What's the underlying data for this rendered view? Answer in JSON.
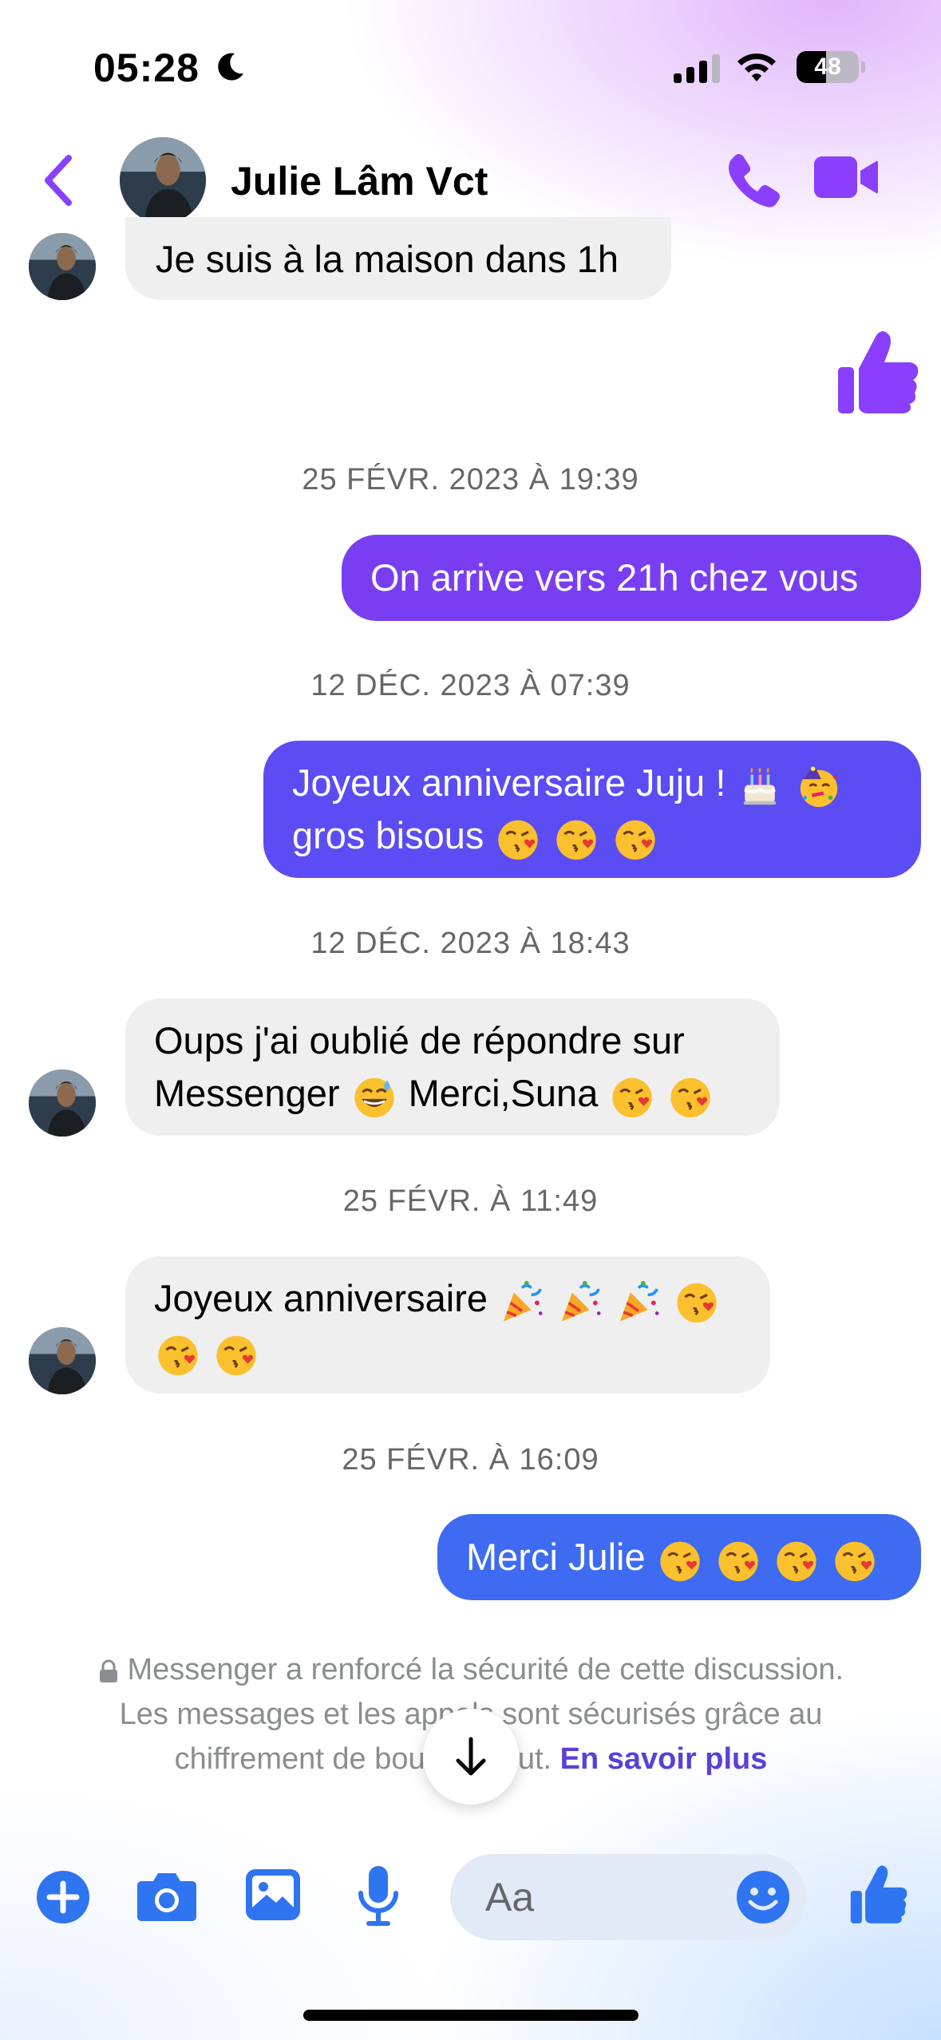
{
  "status_bar": {
    "time": "05:28",
    "battery": "48",
    "battery_fraction": 0.48
  },
  "header": {
    "contact_name": "Julie Lâm Vct"
  },
  "messages": [
    {
      "text": "Je suis à la maison dans 1h"
    },
    {
      "timestamp": "25 FÉVR. 2023 À 19:39"
    },
    {
      "text": "On arrive vers 21h chez vous"
    },
    {
      "timestamp": "12 DÉC. 2023 À 07:39"
    },
    {
      "line1": "Joyeux anniversaire Juju !",
      "line2": "gros bisous"
    },
    {
      "timestamp": "12 DÉC. 2023 À 18:43"
    },
    {
      "line1": "Oups j'ai oublié de répondre sur",
      "line2a": "Messenger",
      "line2b": "Merci,Suna"
    },
    {
      "timestamp": "25 FÉVR. À 11:49"
    },
    {
      "line1": "Joyeux anniversaire"
    },
    {
      "timestamp": "25 FÉVR. À 16:09"
    },
    {
      "text": "Merci Julie"
    }
  ],
  "security_notice": {
    "line1": "Messenger a renforcé la sécurité de cette discussion.",
    "line2": "Les messages et les appels sont sécurisés grâce au",
    "line3": "chiffrement de bout en bout.",
    "link": "En savoir plus"
  },
  "composer": {
    "placeholder": "Aa"
  },
  "colors": {
    "accent_purple": "#8a3ffc",
    "bubble_violet": "#7a3ef2",
    "bubble_indigo": "#5c4cf3",
    "bubble_blue": "#3e6bf1",
    "toolbar_blue": "#2f74f0",
    "incoming_bubble": "#efeff0"
  },
  "icons": [
    "moon-icon",
    "signal-icon",
    "wifi-icon",
    "battery-icon",
    "back-chevron-icon",
    "phone-icon",
    "video-camera-icon",
    "thumbs-up-icon",
    "lock-icon",
    "arrow-down-icon",
    "plus-icon",
    "camera-icon",
    "gallery-icon",
    "microphone-icon",
    "smiley-icon",
    "birthday-cake-emoji",
    "partying-face-emoji",
    "kiss-emoji",
    "grinning-sweat-emoji",
    "party-popper-emoji"
  ]
}
